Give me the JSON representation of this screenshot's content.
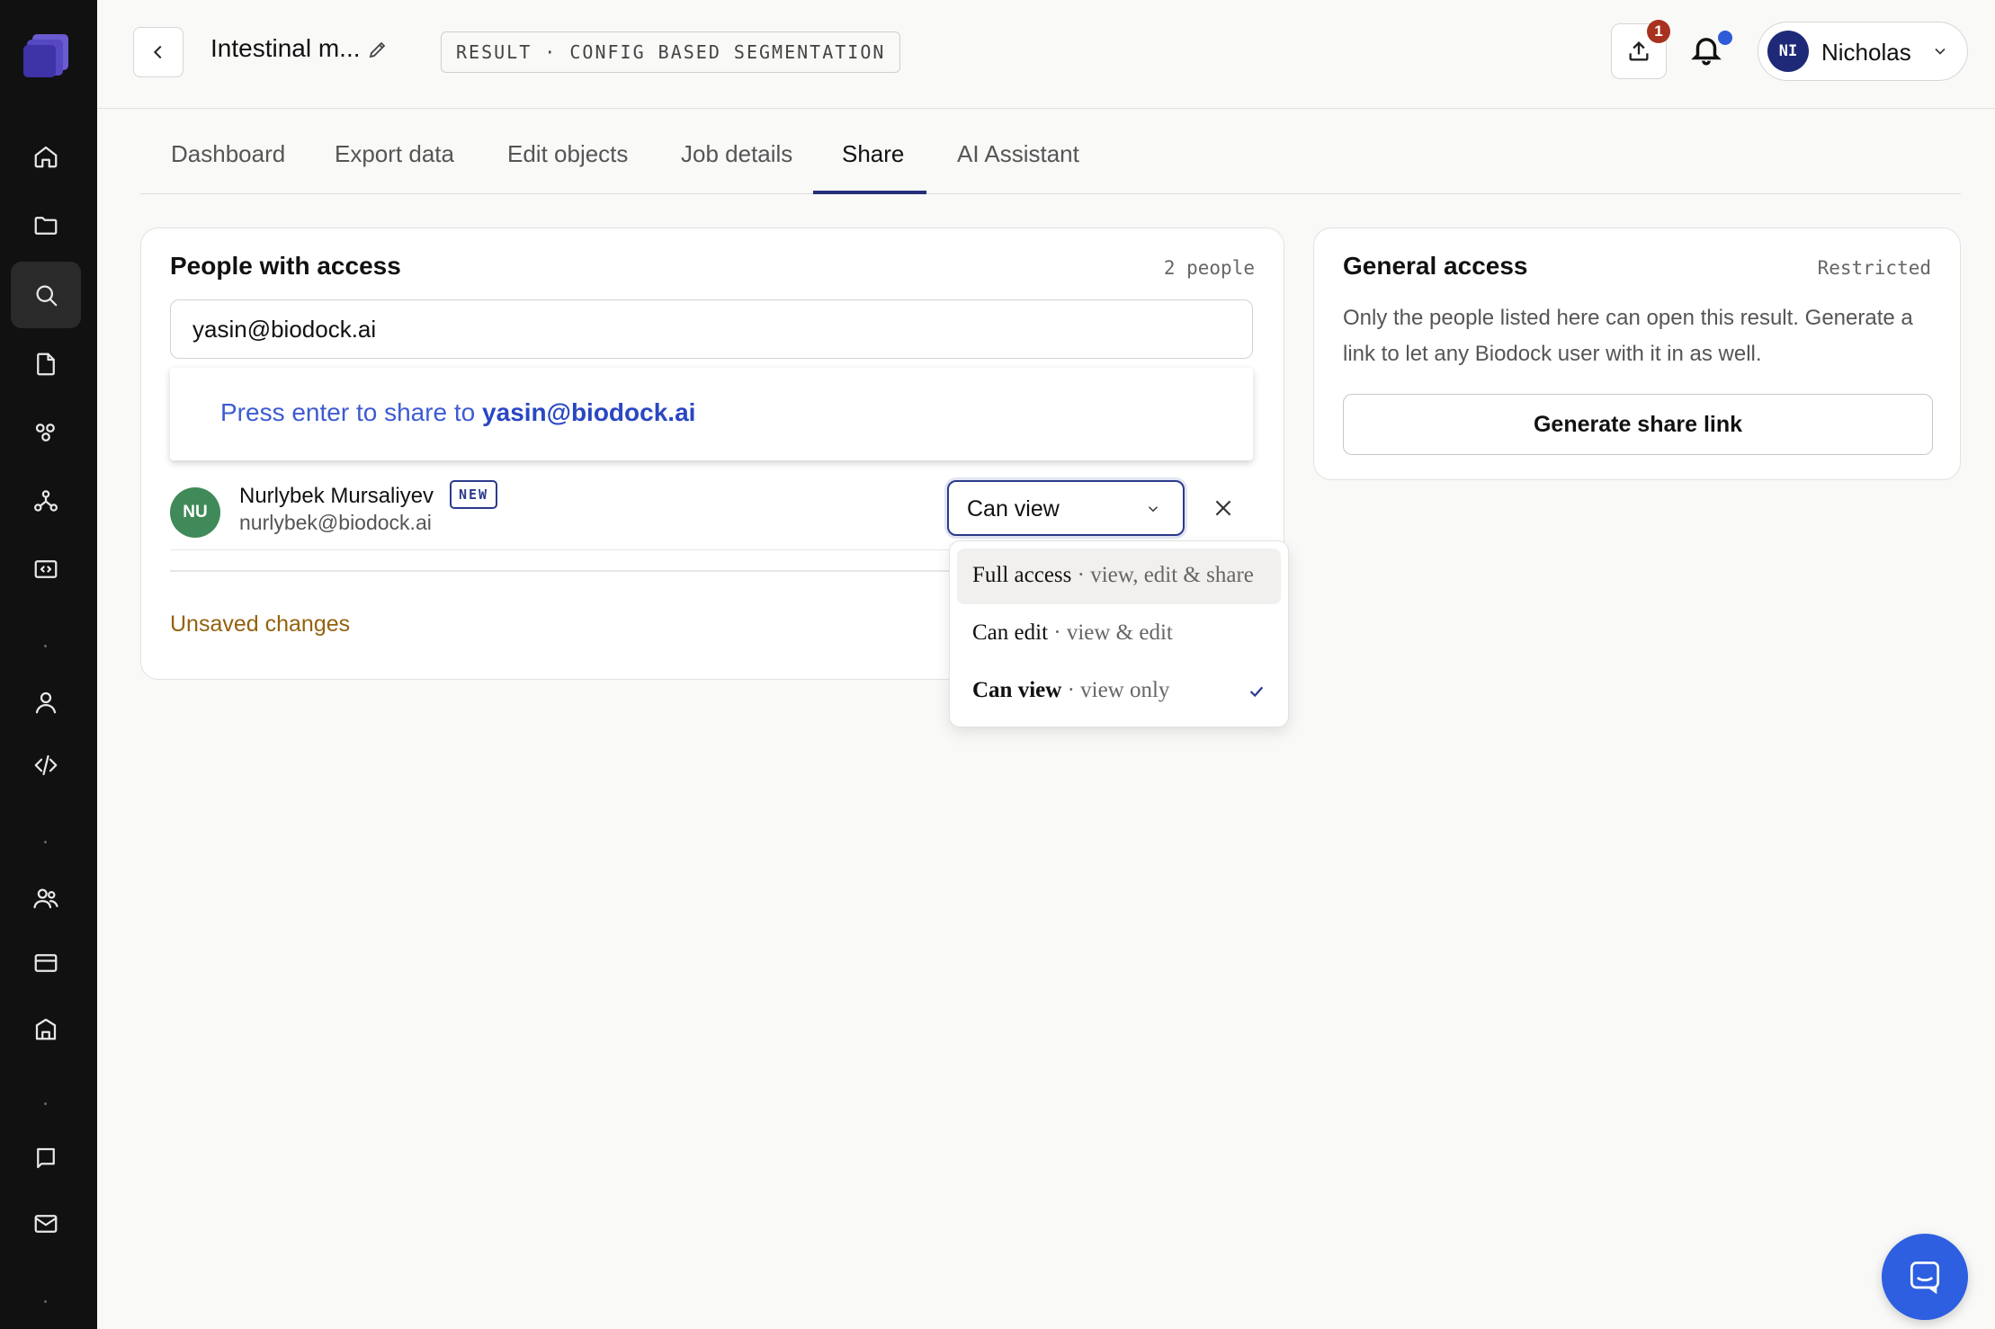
{
  "sidebar": {
    "icons": [
      "home-icon",
      "folder-icon",
      "search-icon",
      "file-icon",
      "nodes-icon",
      "network-icon",
      "code-window-icon",
      "user-icon",
      "code-icon",
      "team-icon",
      "card-icon",
      "building-icon",
      "book-icon",
      "mail-icon"
    ],
    "active": "search-icon"
  },
  "header": {
    "title": "Intestinal m...",
    "result_tag": "RESULT · CONFIG BASED SEGMENTATION",
    "upload_badge": "1",
    "user": {
      "initials": "NI",
      "name": "Nicholas"
    }
  },
  "tabs": [
    {
      "label": "Dashboard"
    },
    {
      "label": "Export data"
    },
    {
      "label": "Edit objects"
    },
    {
      "label": "Job details"
    },
    {
      "label": "Share"
    },
    {
      "label": "AI Assistant"
    }
  ],
  "active_tab": "Share",
  "people_card": {
    "title": "People with access",
    "count": "2 people",
    "input_value": "yasin@biodock.ai",
    "suggestion_prefix": "Press enter to share to ",
    "suggestion_email": "yasin@biodock.ai",
    "person": {
      "initials": "NU",
      "name": "Nurlybek Mursaliyev",
      "badge": "NEW",
      "email": "nurlybek@biodock.ai",
      "role": "Can view"
    },
    "unsaved": "Unsaved changes"
  },
  "general_card": {
    "title": "General access",
    "status": "Restricted",
    "description": "Only the people listed here can open this result. Generate a link to let any Biodock user with it in as well.",
    "button": "Generate share link"
  },
  "role_menu": [
    {
      "label": "Full access",
      "detail": " · view, edit & share",
      "selected": false
    },
    {
      "label": "Can edit",
      "detail": " · view & edit",
      "selected": false
    },
    {
      "label": "Can view",
      "detail": " · view only",
      "selected": true
    }
  ],
  "colors": {
    "accent": "#2b3a8c",
    "link": "#3d5bd1",
    "warning": "#94620f",
    "chat": "#2d5fe0"
  }
}
